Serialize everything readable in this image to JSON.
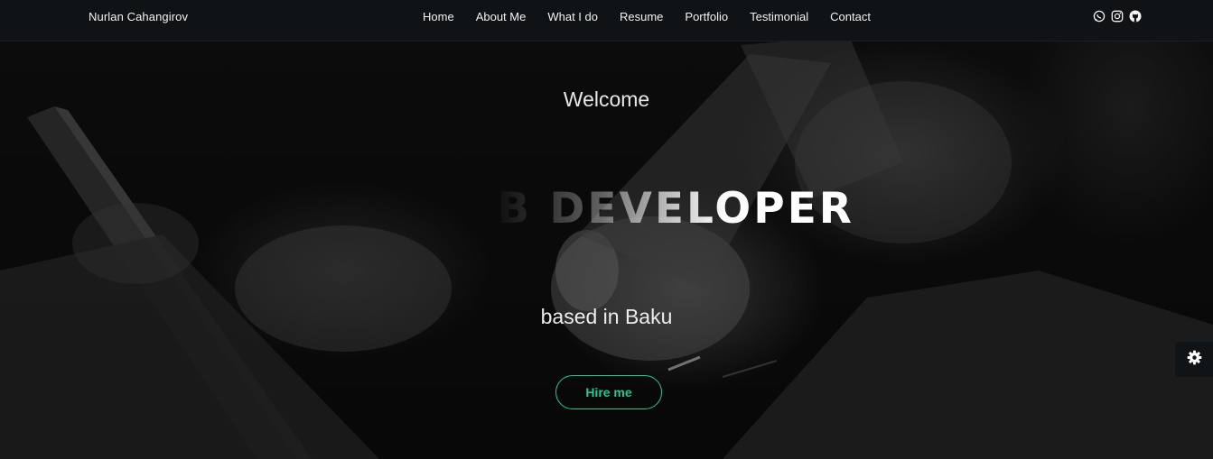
{
  "brand": {
    "name": "Nurlan Cahangirov"
  },
  "nav": {
    "items": [
      {
        "label": "Home"
      },
      {
        "label": "About Me"
      },
      {
        "label": "What I do"
      },
      {
        "label": "Resume"
      },
      {
        "label": "Portfolio"
      },
      {
        "label": "Testimonial"
      },
      {
        "label": "Contact"
      }
    ],
    "socials": [
      {
        "icon": "whatsapp-icon"
      },
      {
        "icon": "instagram-icon"
      },
      {
        "icon": "github-icon"
      }
    ]
  },
  "hero": {
    "welcome": "Welcome",
    "typed_text": "B DEVELOPER",
    "location_text": "based in Baku",
    "hire_label": "Hire me"
  },
  "colors": {
    "accent": "#20c997",
    "navbar_bg": "#101316",
    "hero_bg": "#050505"
  },
  "settings": {
    "icon": "gear-icon"
  }
}
